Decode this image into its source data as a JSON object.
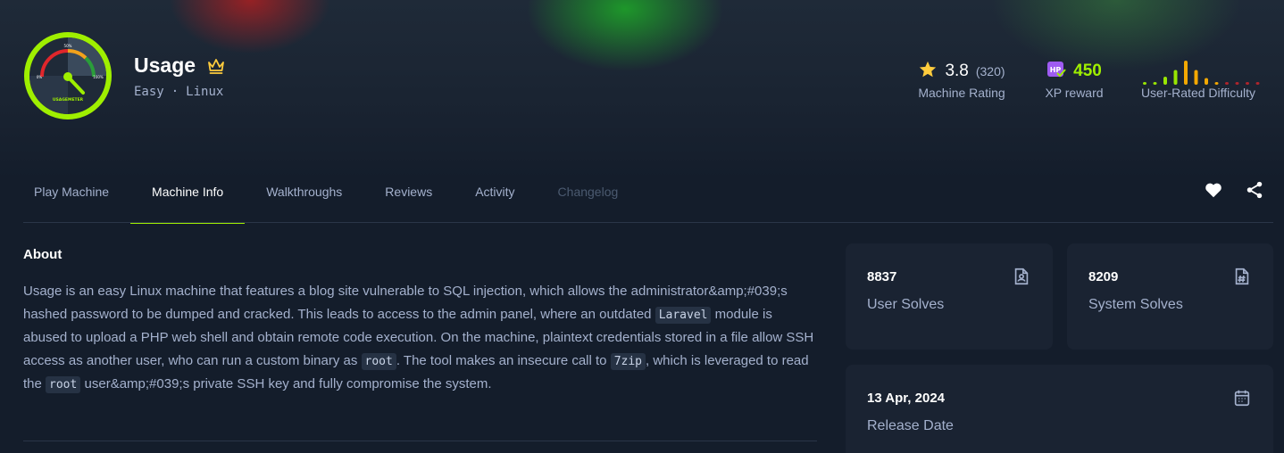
{
  "machine": {
    "name": "Usage",
    "difficulty": "Easy",
    "separator": "·",
    "os": "Linux",
    "logo_icon": "usagemeter-logo-icon",
    "logo_text": "USAGEMETER"
  },
  "stats": {
    "rating_value": "3.8",
    "rating_count": "(320)",
    "rating_label": "Machine Rating",
    "xp_value": "450",
    "xp_label": "XP reward",
    "difficulty_label": "User-Rated Difficulty",
    "difficulty_bars": [
      0.1,
      0.1,
      0.3,
      0.55,
      0.9,
      0.55,
      0.25,
      0.08,
      0.08,
      0.08,
      0.06,
      0.05
    ]
  },
  "tabs": [
    {
      "label": "Play Machine",
      "state": "normal"
    },
    {
      "label": "Machine Info",
      "state": "active"
    },
    {
      "label": "Walkthroughs",
      "state": "normal"
    },
    {
      "label": "Reviews",
      "state": "normal"
    },
    {
      "label": "Activity",
      "state": "normal"
    },
    {
      "label": "Changelog",
      "state": "disabled"
    }
  ],
  "about": {
    "title": "About",
    "p1": "Usage is an easy Linux machine that features a blog site vulnerable to SQL injection, which allows the administrator&amp;#039;s hashed password to be dumped and cracked. This leads to access to the admin panel, where an outdated ",
    "code1": "Laravel",
    "p2": " module is abused to upload a PHP web shell and obtain remote code execution. On the machine, plaintext credentials stored in a file allow SSH access as another user, who can run a custom binary as ",
    "code2": "root",
    "p3": ". The tool makes an insecure call to ",
    "code3": "7zip",
    "p4": ", which is leveraged to read the ",
    "code4": "root",
    "p5": " user&amp;#039;s private SSH key and fully compromise the system."
  },
  "cards": {
    "user_solves_value": "8837",
    "user_solves_label": "User Solves",
    "system_solves_value": "8209",
    "system_solves_label": "System Solves",
    "release_value": "13 Apr, 2024",
    "release_label": "Release Date"
  },
  "colors": {
    "accent": "#9fef00",
    "background": "#141d2b",
    "card": "#1a2332",
    "star": "#ffcc3d",
    "difficulty_easy": "#9fef00",
    "difficulty_medium": "#ffaf00"
  },
  "icons": {
    "crown": "crown-icon",
    "star": "star-icon",
    "xp": "xp-badge-icon",
    "favorite": "heart-icon",
    "share": "share-icon",
    "user_solves": "user-file-icon",
    "system_solves": "hash-file-icon",
    "release": "calendar-icon"
  }
}
